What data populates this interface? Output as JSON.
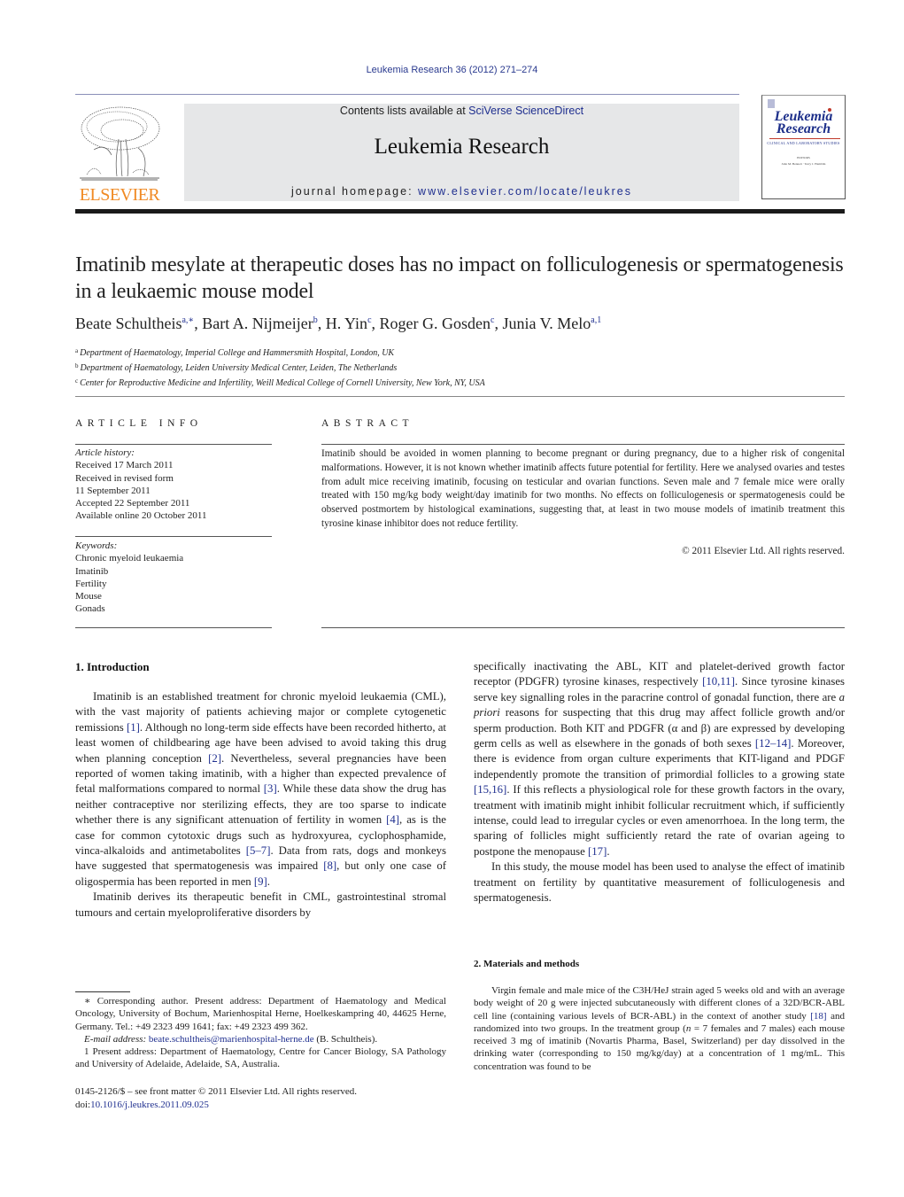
{
  "header": {
    "citation": "Leukemia Research 36 (2012) 271–274",
    "publisher_logo_text": "ELSEVIER",
    "contents_prefix": "Contents lists available at ",
    "contents_link": "SciVerse ScienceDirect",
    "journal_name": "Leukemia Research",
    "homepage_prefix": "journal homepage: ",
    "homepage_url": "www.elsevier.com/locate/leukres",
    "cover": {
      "title_line1": "Leukemia",
      "title_line2": "Research",
      "subtitle": "CLINICAL AND LABORATORY STUDIES",
      "small1": "EDITORS",
      "small2": "John M. Bennett · Terry J. Hamblin"
    }
  },
  "article": {
    "title": "Imatinib mesylate at therapeutic doses has no impact on folliculogenesis or spermatogenesis in a leukaemic mouse model",
    "authors": [
      {
        "name": "Beate Schultheis",
        "sup": "a,∗",
        "sep": ", "
      },
      {
        "name": "Bart A. Nijmeijer",
        "sup": "b",
        "sep": ", "
      },
      {
        "name": "H. Yin",
        "sup": "c",
        "sep": ", "
      },
      {
        "name": "Roger G. Gosden",
        "sup": "c",
        "sep": ", "
      },
      {
        "name": "Junia V. Melo",
        "sup": "a,1",
        "sep": ""
      }
    ],
    "affiliations": [
      {
        "sup": "a",
        "text": "Department of Haematology, Imperial College and Hammersmith Hospital, London, UK"
      },
      {
        "sup": "b",
        "text": "Department of Haematology, Leiden University Medical Center, Leiden, The Netherlands"
      },
      {
        "sup": "c",
        "text": "Center for Reproductive Medicine and Infertility, Weill Medical College of Cornell University, New York, NY, USA"
      }
    ]
  },
  "article_info": {
    "heading": "ARTICLE INFO",
    "history_label": "Article history:",
    "history": [
      "Received 17 March 2011",
      "Received in revised form",
      "11 September 2011",
      "Accepted 22 September 2011",
      "Available online 20 October 2011"
    ],
    "keywords_label": "Keywords:",
    "keywords": [
      "Chronic myeloid leukaemia",
      "Imatinib",
      "Fertility",
      "Mouse",
      "Gonads"
    ]
  },
  "abstract": {
    "heading": "ABSTRACT",
    "text": "Imatinib should be avoided in women planning to become pregnant or during pregnancy, due to a higher risk of congenital malformations. However, it is not known whether imatinib affects future potential for fertility. Here we analysed ovaries and testes from adult mice receiving imatinib, focusing on tes­ticular and ovarian functions. Seven male and 7 female mice were orally treated with 150 mg/kg body weight/day imatinib for two months. No effects on folliculogenesis or spermatogenesis could be observed postmortem by histological examinations, suggesting that, at least in two mouse models of imatinib treatment this tyrosine kinase inhibitor does not reduce fertility.",
    "copyright": "© 2011 Elsevier Ltd. All rights reserved."
  },
  "body": {
    "section1_heading": "1.  Introduction",
    "intro_p1": [
      {
        "t": "Imatinib is an established treatment for chronic myeloid leukaemia (CML), with the vast majority of patients achieving major or complete cytogenetic remissions "
      },
      {
        "ref": "[1]"
      },
      {
        "t": ". Although no long-term side effects have been recorded hitherto, at least women of childbearing age have been advised to avoid taking this drug when planning con­ception "
      },
      {
        "ref": "[2]"
      },
      {
        "t": ". Nevertheless, several pregnancies have been reported of women taking imatinib, with a higher than expected prevalence of fetal malformations compared to normal "
      },
      {
        "ref": "[3]"
      },
      {
        "t": ". While these data show the drug has neither contraceptive nor sterilizing effects, they are too sparse to indicate whether there is any significant attenua­tion of fertility in women "
      },
      {
        "ref": "[4]"
      },
      {
        "t": ", as is the case for common cytotoxic drugs such as hydroxyurea, cyclophosphamide, vinca-alkaloids and antimetabolites "
      },
      {
        "ref": "[5–7]"
      },
      {
        "t": ". Data from rats, dogs and monkeys have sug­gested that spermatogenesis was impaired "
      },
      {
        "ref": "[8]"
      },
      {
        "t": ", but only one case of oligospermia has been reported in men "
      },
      {
        "ref": "[9]"
      },
      {
        "t": "."
      }
    ],
    "intro_p2_left": "Imatinib derives its therapeutic benefit in CML, gastrointesti­nal stromal tumours and certain myeloproliferative disorders by",
    "intro_p2_right": [
      {
        "t": "specifically inactivating the ABL, KIT and platelet-derived growth factor receptor (PDGFR) tyrosine kinases, respectively "
      },
      {
        "ref": "[10,11]"
      },
      {
        "t": ". Since tyrosine kinases serve key signalling roles in the paracrine control of gonadal function, there are "
      },
      {
        "i": "a priori"
      },
      {
        "t": " reasons for suspecting that this drug may affect follicle growth and/or sperm production. Both KIT and PDGFR (α and β) are expressed by developing germ cells as well as elsewhere in the gonads of both sexes "
      },
      {
        "ref": "[12–14]"
      },
      {
        "t": ". Moreover, there is evidence from organ culture experiments that KIT-ligand and PDGF independently promote the transition of primordial follicles to a growing state "
      },
      {
        "ref": "[15,16]"
      },
      {
        "t": ". If this reflects a phys­iological role for these growth factors in the ovary, treatment with imatinib might inhibit follicular recruitment which, if sufficiently intense, could lead to irregular cycles or even amenorrhoea. In the long term, the sparing of follicles might sufficiently retard the rate of ovarian ageing to postpone the menopause "
      },
      {
        "ref": "[17]"
      },
      {
        "t": "."
      }
    ],
    "intro_p3": "In this study, the mouse model has been used to analyse the effect of imatinib treatment on fertility by quantitative measure­ment of folliculogenesis and spermatogenesis.",
    "section2_heading": "2.  Materials and methods",
    "methods_p1": [
      {
        "t": "Virgin female and male mice of the C3H/HeJ strain aged 5 weeks old and with an average body weight of 20 g were injected subcutaneously with differ­ent clones of a 32D/BCR-ABL cell line (containing various levels of BCR-ABL) in the context of another study "
      },
      {
        "ref": "[18]"
      },
      {
        "t": " and randomized into two groups. In the treatment group ("
      },
      {
        "i": "n"
      },
      {
        "t": " = 7 females and 7 males) each mouse received 3 mg of imatinib (Novartis Pharma, Basel, Switzerland) per day dissolved in the drinking water (corresponding to 150 mg/kg/day) at a concentration of 1 mg/mL. This concentration was found to be"
      }
    ]
  },
  "footnotes": {
    "corresponding": "∗  Corresponding author. Present address: Department of Haematology and Med­ical Oncology, University of Bochum, Marienhospital Herne, Hoelkeskampring 40, 44625 Herne, Germany. Tel.: +49 2323 499 1641; fax: +49 2323 499 362.",
    "email_label": "E-mail address: ",
    "email": "beate.schultheis@marienhospital-herne.de",
    "email_suffix": " (B. Schultheis).",
    "present_address": "1  Present address: Department of Haematology, Centre for Cancer Biology, SA Pathology and University of Adelaide, Adelaide, SA, Australia.",
    "front_matter": "0145-2126/$ – see front matter © 2011 Elsevier Ltd. All rights reserved.",
    "doi_prefix": "doi:",
    "doi": "10.1016/j.leukres.2011.09.025"
  },
  "colors": {
    "link": "#1f2f8f",
    "elsevier_orange": "#f08a24",
    "masthead_bg": "#e6e7e8"
  }
}
